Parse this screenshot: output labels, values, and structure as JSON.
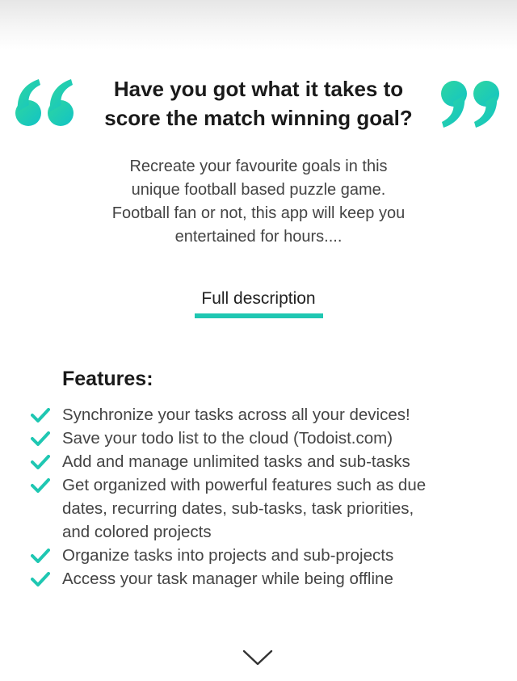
{
  "headline": {
    "line1": "Have you got what it takes to",
    "line2": "score the match winning goal?"
  },
  "intro": {
    "lines": [
      "Recreate your favourite goals in this",
      "unique football based puzzle game.",
      "Football fan or not, this app will keep you",
      "entertained for hours...."
    ]
  },
  "full_description_link": "Full description",
  "features": {
    "title": "Features:",
    "items": [
      {
        "lines": [
          "Synchronize your tasks across all your devices!"
        ]
      },
      {
        "lines": [
          "Save your todo list to the cloud (Todoist.com)"
        ]
      },
      {
        "lines": [
          "Add and manage unlimited tasks and sub-tasks"
        ]
      },
      {
        "lines": [
          "Get organized with powerful features such as due",
          "dates, recurring dates, sub-tasks, task priorities,",
          "and colored projects"
        ]
      },
      {
        "lines": [
          "Organize tasks into projects and sub-projects"
        ]
      },
      {
        "lines": [
          "Access your task manager while being offline"
        ]
      }
    ]
  },
  "colors": {
    "accent_start": "#2bd3a6",
    "accent_end": "#14c4c4",
    "underline": "#1fc7b2"
  },
  "icons": {
    "quote_open": "open-quote-icon",
    "quote_close": "close-quote-icon",
    "check": "checkmark-icon",
    "scroll": "chevron-down-icon"
  }
}
